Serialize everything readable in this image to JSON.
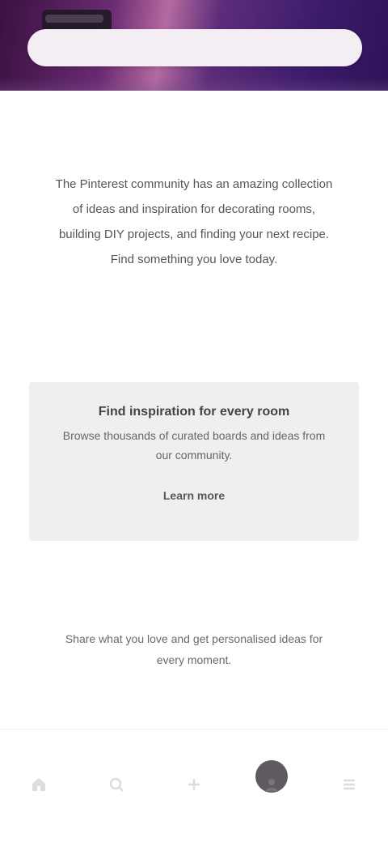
{
  "header": {
    "logo_name": "site-logo",
    "search_placeholder": ""
  },
  "intro": {
    "kicker": "",
    "text": "The Pinterest community has an amazing collection of ideas and inspiration for decorating rooms, building DIY projects, and finding your next recipe. Find something you love today."
  },
  "card": {
    "title": "Find inspiration for every room",
    "body": "Browse thousands of curated boards and ideas from our community.",
    "link_label": "Learn more"
  },
  "footer": {
    "kicker": "",
    "text": "Share what you love and get personalised ideas for every moment."
  },
  "bottom_nav": {
    "items": [
      {
        "icon": "home-icon",
        "label": ""
      },
      {
        "icon": "search-icon",
        "label": ""
      },
      {
        "icon": "plus-icon",
        "label": ""
      },
      {
        "icon": "profile-icon",
        "label": ""
      },
      {
        "icon": "menu-icon",
        "label": ""
      }
    ],
    "active_index": 3
  },
  "colors": {
    "header_dark": "#3a1141",
    "header_accent": "#b46aa0",
    "card_bg": "#f1eef1",
    "active_nav": "#5e5a60"
  }
}
